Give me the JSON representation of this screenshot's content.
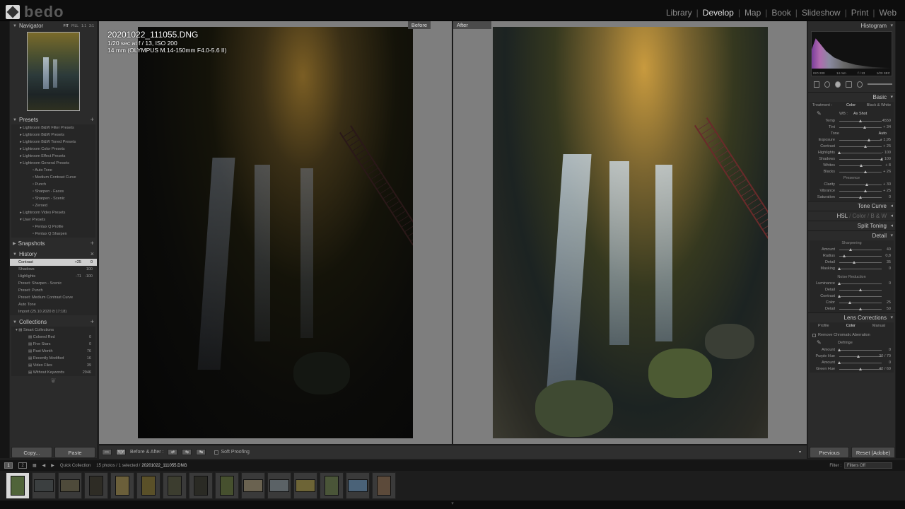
{
  "app": {
    "logo_text": "bedo"
  },
  "modules": [
    "Library",
    "Develop",
    "Map",
    "Book",
    "Slideshow",
    "Print",
    "Web"
  ],
  "active_module": "Develop",
  "navigator": {
    "title": "Navigator",
    "zoom_fit": "FIT",
    "zoom_fill": "FILL",
    "zoom_1": "1:1",
    "zoom_3": "3:1"
  },
  "presets": {
    "title": "Presets",
    "items": [
      "Lightroom B&W Filter Presets",
      "Lightroom B&W Presets",
      "Lightroom B&W Toned Presets",
      "Lightroom Color Presets",
      "Lightroom Effect Presets",
      "Lightroom General Presets",
      "Auto Tone",
      "Medium Contrast Curve",
      "Punch",
      "Sharpen - Faces",
      "Sharpen - Scenic",
      "Zeroed",
      "Lightroom Video Presets",
      "User Presets",
      "Pentax Q Profile",
      "Pentax Q Sharpen"
    ]
  },
  "snapshots": {
    "title": "Snapshots"
  },
  "history": {
    "title": "History",
    "items": [
      {
        "label": "Contrast",
        "a": "+25",
        "b": "0"
      },
      {
        "label": "Shadows",
        "a": "",
        "b": "100"
      },
      {
        "label": "Highlights",
        "a": "-71",
        "b": "-100"
      },
      {
        "label": "Preset: Sharpen - Scenic",
        "a": "",
        "b": ""
      },
      {
        "label": "Preset: Punch",
        "a": "",
        "b": ""
      },
      {
        "label": "Preset: Medium Contrast Curve",
        "a": "",
        "b": ""
      },
      {
        "label": "Auto Tone",
        "a": "",
        "b": ""
      },
      {
        "label": "Import (25.10.2020 8:17:18)",
        "a": "",
        "b": ""
      }
    ]
  },
  "collections": {
    "title": "Collections",
    "group": "Smart Collections",
    "items": [
      {
        "label": "Colored Red",
        "count": "0"
      },
      {
        "label": "Five Stars",
        "count": "0"
      },
      {
        "label": "Past Month",
        "count": "76"
      },
      {
        "label": "Recently Modified",
        "count": "16"
      },
      {
        "label": "Video Files",
        "count": "39"
      },
      {
        "label": "Without Keywords",
        "count": "2946"
      }
    ]
  },
  "left_buttons": {
    "copy": "Copy...",
    "paste": "Paste"
  },
  "photo_info": {
    "filename": "20201022_111055.DNG",
    "exposure": "1/20 sec at f / 13, ISO 200",
    "lens": "14 mm (OLYMPUS M.14-150mm F4.0-5.6 II)"
  },
  "panes": {
    "before": "Before",
    "after": "After"
  },
  "toolbar": {
    "before_after": "Before & After :",
    "soft_proofing": "Soft Proofing"
  },
  "histogram": {
    "title": "Histogram",
    "iso": "ISO 200",
    "focal": "14 mm",
    "aperture": "f / 13",
    "shutter": "1/20 SEC"
  },
  "basic": {
    "title": "Basic",
    "treatment_label": "Treatment :",
    "treatment_color": "Color",
    "treatment_bw": "Black & White",
    "wb_label": "WB :",
    "wb_value": "As Shot",
    "wb_rows": [
      {
        "label": "Temp",
        "value": "4550",
        "pos": 0.5
      },
      {
        "label": "Tint",
        "value": "+ 34",
        "pos": 0.6
      }
    ],
    "tone_label": "Tone",
    "tone_auto": "Auto",
    "tone_rows": [
      {
        "label": "Exposure",
        "value": "+ 1,95",
        "pos": 0.7
      },
      {
        "label": "Contrast",
        "value": "+ 25",
        "pos": 0.62
      },
      {
        "label": "Highlights",
        "value": "- 100",
        "pos": 0.0
      },
      {
        "label": "Shadows",
        "value": "+ 100",
        "pos": 1.0
      },
      {
        "label": "Whites",
        "value": "+ 8",
        "pos": 0.53
      },
      {
        "label": "Blacks",
        "value": "+ 26",
        "pos": 0.63
      }
    ],
    "presence_label": "Presence",
    "presence_rows": [
      {
        "label": "Clarity",
        "value": "+ 30",
        "pos": 0.65
      },
      {
        "label": "Vibrance",
        "value": "+ 25",
        "pos": 0.62
      },
      {
        "label": "Saturation",
        "value": "0",
        "pos": 0.5
      }
    ]
  },
  "tone_curve": {
    "title": "Tone Curve"
  },
  "hsl": {
    "hsl": "HSL",
    "color": "Color",
    "bw": "B & W"
  },
  "split_toning": {
    "title": "Split Toning"
  },
  "detail": {
    "title": "Detail",
    "sharpening_label": "Sharpening",
    "sharpening_rows": [
      {
        "label": "Amount",
        "value": "40",
        "pos": 0.27
      },
      {
        "label": "Radius",
        "value": "0,8",
        "pos": 0.12
      },
      {
        "label": "Detail",
        "value": "35",
        "pos": 0.35
      },
      {
        "label": "Masking",
        "value": "0",
        "pos": 0.0
      }
    ],
    "noise_label": "Noise Reduction",
    "noise_rows": [
      {
        "label": "Luminance",
        "value": "0",
        "pos": 0.0
      },
      {
        "label": "Detail",
        "value": "",
        "pos": 0.5
      },
      {
        "label": "Contrast",
        "value": "",
        "pos": 0.0
      },
      {
        "label": "Color",
        "value": "25",
        "pos": 0.25
      },
      {
        "label": "Detail",
        "value": "50",
        "pos": 0.5
      }
    ]
  },
  "lens": {
    "title": "Lens Corrections",
    "tabs": [
      "Profile",
      "Color",
      "Manual"
    ],
    "chromatic": "Remove Chromatic Aberration",
    "defringe": "Defringe",
    "rows": [
      {
        "label": "Amount",
        "value": "0",
        "pos": 0.0
      },
      {
        "label": "Purple Hue",
        "value": "30 / 70",
        "pos": 0.45
      },
      {
        "label": "Amount",
        "value": "0",
        "pos": 0.0
      },
      {
        "label": "Green Hue",
        "value": "40 / 60",
        "pos": 0.5
      }
    ]
  },
  "right_buttons": {
    "previous": "Previous",
    "reset": "Reset (Adobe)"
  },
  "filmstrip": {
    "page1": "1",
    "page2": "2",
    "source": "Quick Collection",
    "count": "15 photos / 1 selected /",
    "selected_file": "20201022_111055.DNG",
    "filter_label": "Filter :",
    "filter_value": "Filters Off"
  }
}
